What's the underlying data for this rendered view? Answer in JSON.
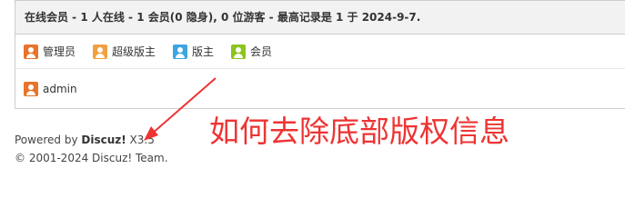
{
  "online": {
    "header_text": "在线会员 - 1 人在线 - 1 会员(0 隐身), 0 位游客 - 最高记录是 1 于 2024-9-7.",
    "legend": [
      {
        "label": "管理员",
        "color": "#e8732a",
        "icon": "admin-user-icon"
      },
      {
        "label": "超级版主",
        "color": "#f0a040",
        "icon": "super-moderator-user-icon"
      },
      {
        "label": "版主",
        "color": "#3ca6e0",
        "icon": "moderator-user-icon"
      },
      {
        "label": "会员",
        "color": "#8cc420",
        "icon": "member-user-icon"
      }
    ],
    "members": [
      {
        "name": "admin",
        "color": "#e8732a",
        "icon": "admin-user-icon"
      }
    ]
  },
  "footer": {
    "powered_prefix": "Powered by ",
    "brand": "Discuz!",
    "version": " X3.5",
    "copyright": "© 2001-2024 Discuz! Team."
  },
  "annotation": {
    "text": "如何去除底部版权信息",
    "color": "#ee3333"
  }
}
